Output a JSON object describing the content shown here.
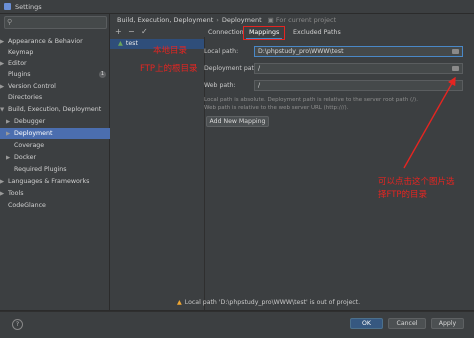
{
  "window": {
    "title": "Settings"
  },
  "search": {
    "placeholder": ""
  },
  "sidebar": {
    "items": [
      {
        "label": "Appearance & Behavior"
      },
      {
        "label": "Keymap"
      },
      {
        "label": "Editor"
      },
      {
        "label": "Plugins",
        "badge": "1"
      },
      {
        "label": "Version Control"
      },
      {
        "label": "Directories"
      },
      {
        "label": "Build, Execution, Deployment"
      },
      {
        "label": "Debugger"
      },
      {
        "label": "Deployment"
      },
      {
        "label": "Coverage"
      },
      {
        "label": "Docker"
      },
      {
        "label": "Required Plugins"
      },
      {
        "label": "Languages & Frameworks"
      },
      {
        "label": "Tools"
      },
      {
        "label": "CodeGlance"
      }
    ]
  },
  "breadcrumb": {
    "parent": "Build, Execution, Deployment",
    "sep": "›",
    "current": "Deployment",
    "note": "For current project"
  },
  "server_toolbar": {
    "add": "+",
    "remove": "−",
    "apply": "✓"
  },
  "servers": [
    {
      "label": "test"
    }
  ],
  "tabs": [
    {
      "label": "Connection"
    },
    {
      "label": "Mappings"
    },
    {
      "label": "Excluded Paths"
    }
  ],
  "mappings": {
    "local_path_label": "Local path:",
    "local_path_value": "D:\\phpstudy_pro\\WWW\\test",
    "deployment_path_label": "Deployment path:",
    "deployment_path_value": "/",
    "web_path_label": "Web path:",
    "web_path_value": "/",
    "help_line1": "Local path is absolute. Deployment path is relative to the server root path (/).",
    "help_line2": "Web path is relative to the web server URL (http:///).",
    "add_mapping": "Add New Mapping"
  },
  "annotations": {
    "local_dir": "本地目录",
    "ftp_dir": "FTP上的根目录",
    "click_icon_line1": "可以点击这个图片选",
    "click_icon_line2": "择FTP的目录"
  },
  "warning": {
    "text": "Local path 'D:\\phpstudy_pro\\WWW\\test' is out of project."
  },
  "footer": {
    "help": "?",
    "ok": "OK",
    "cancel": "Cancel",
    "apply": "Apply"
  },
  "colors": {
    "accent": "#4b6eaf",
    "annotation": "#e52521",
    "warning": "#f0a732"
  }
}
